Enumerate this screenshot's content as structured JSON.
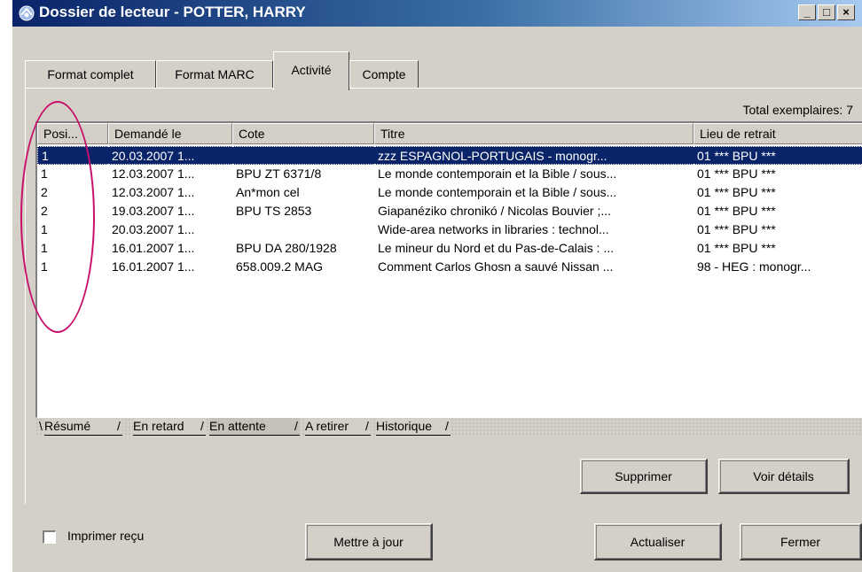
{
  "window": {
    "title": "Dossier de lecteur - POTTER, HARRY",
    "controls": [
      "_",
      "□",
      "×"
    ]
  },
  "tabs": [
    {
      "label": "Format complet",
      "active": false
    },
    {
      "label": "Format MARC",
      "active": false
    },
    {
      "label": "Activité",
      "active": true
    },
    {
      "label": "Compte",
      "active": false
    }
  ],
  "total_label": "Total exemplaires: 7",
  "list": {
    "columns": [
      "Posi...",
      "Demandé le",
      "Cote",
      "Titre",
      "Lieu de retrait"
    ],
    "rows": [
      [
        "1",
        "20.03.2007 1...",
        "",
        "zzz ESPAGNOL-PORTUGAIS - monogr...",
        "01 *** BPU ***"
      ],
      [
        "1",
        "12.03.2007 1...",
        "BPU ZT 6371/8",
        "Le monde contemporain et la Bible / sous...",
        "01 *** BPU ***"
      ],
      [
        "2",
        "12.03.2007 1...",
        "An*mon cel",
        "Le monde contemporain et la Bible / sous...",
        "01 *** BPU ***"
      ],
      [
        "2",
        "19.03.2007 1...",
        "BPU TS 2853",
        "Giapanéziko chronikó / Nicolas Bouvier ;...",
        "01 *** BPU ***"
      ],
      [
        "1",
        "20.03.2007 1...",
        "",
        "Wide-area networks in libraries : technol...",
        "01 *** BPU ***"
      ],
      [
        "1",
        "16.01.2007 1...",
        "BPU DA 280/1928",
        "Le mineur du Nord et du Pas-de-Calais : ...",
        "01 *** BPU ***"
      ],
      [
        "1",
        "16.01.2007 1...",
        "658.009.2 MAG",
        "Comment Carlos Ghosn a sauvé Nissan ...",
        "98 - HEG : monogr..."
      ]
    ],
    "selected_row": 0
  },
  "subtabs": [
    {
      "label": "Résumé",
      "active": false
    },
    {
      "label": "En retard",
      "active": false
    },
    {
      "label": "En attente",
      "active": true
    },
    {
      "label": "A retirer",
      "active": false
    },
    {
      "label": "Historique",
      "active": false
    }
  ],
  "buttons": {
    "delete": "Supprimer",
    "details": "Voir détails",
    "update": "Mettre à jour",
    "refresh": "Actualiser",
    "close": "Fermer"
  },
  "print_receipt": {
    "label": "Imprimer reçu",
    "checked": false
  },
  "colors": {
    "selection": "#0a246a",
    "annotation": "#c8106a",
    "face": "#d4d0c8"
  }
}
